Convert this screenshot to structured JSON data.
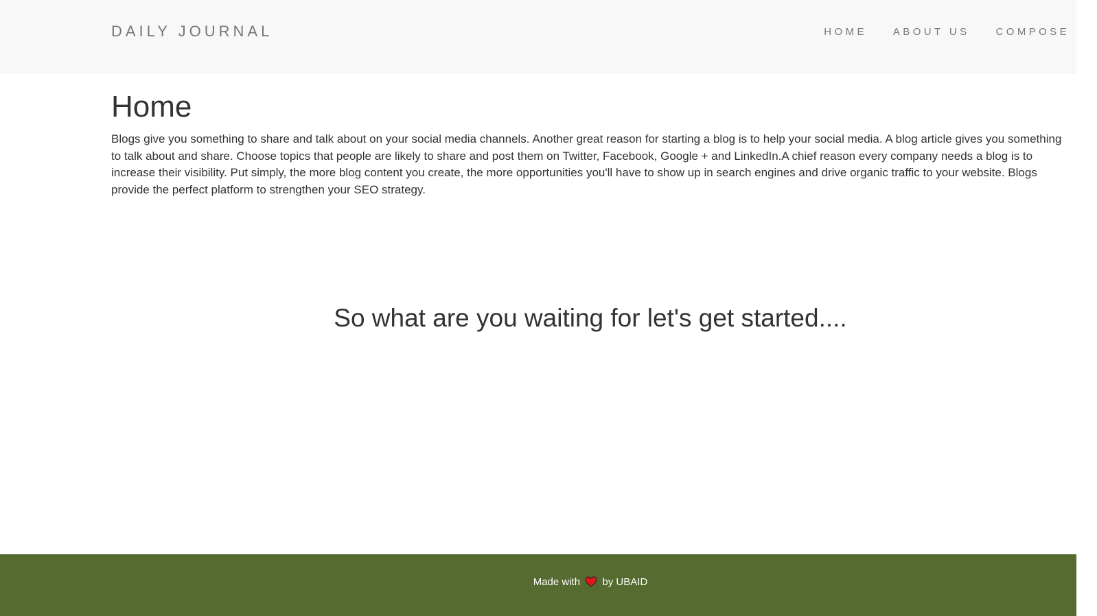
{
  "navbar": {
    "brand": "DAILY JOURNAL",
    "links": [
      {
        "label": "HOME"
      },
      {
        "label": "ABOUT US"
      },
      {
        "label": "COMPOSE"
      }
    ]
  },
  "main": {
    "title": "Home",
    "intro": "Blogs give you something to share and talk about on your social media channels. Another great reason for starting a blog is to help your social media. A blog article gives you something to talk about and share. Choose topics that people are likely to share and post them on Twitter, Facebook, Google + and LinkedIn.A chief reason every company needs a blog is to increase their visibility. Put simply, the more blog content you create, the more opportunities you'll have to show up in search engines and drive organic traffic to your website. Blogs provide the perfect platform to strengthen your SEO strategy.",
    "cta": "So what are you waiting for let's get started...."
  },
  "footer": {
    "made_with": "Made with",
    "heart_icon": "heart-icon",
    "by": "by UBAID"
  },
  "colors": {
    "navbar_bg": "#f8f8f8",
    "nav_text": "#777777",
    "body_text": "#333333",
    "footer_bg": "#556b2f",
    "heart": "#e0161e"
  }
}
